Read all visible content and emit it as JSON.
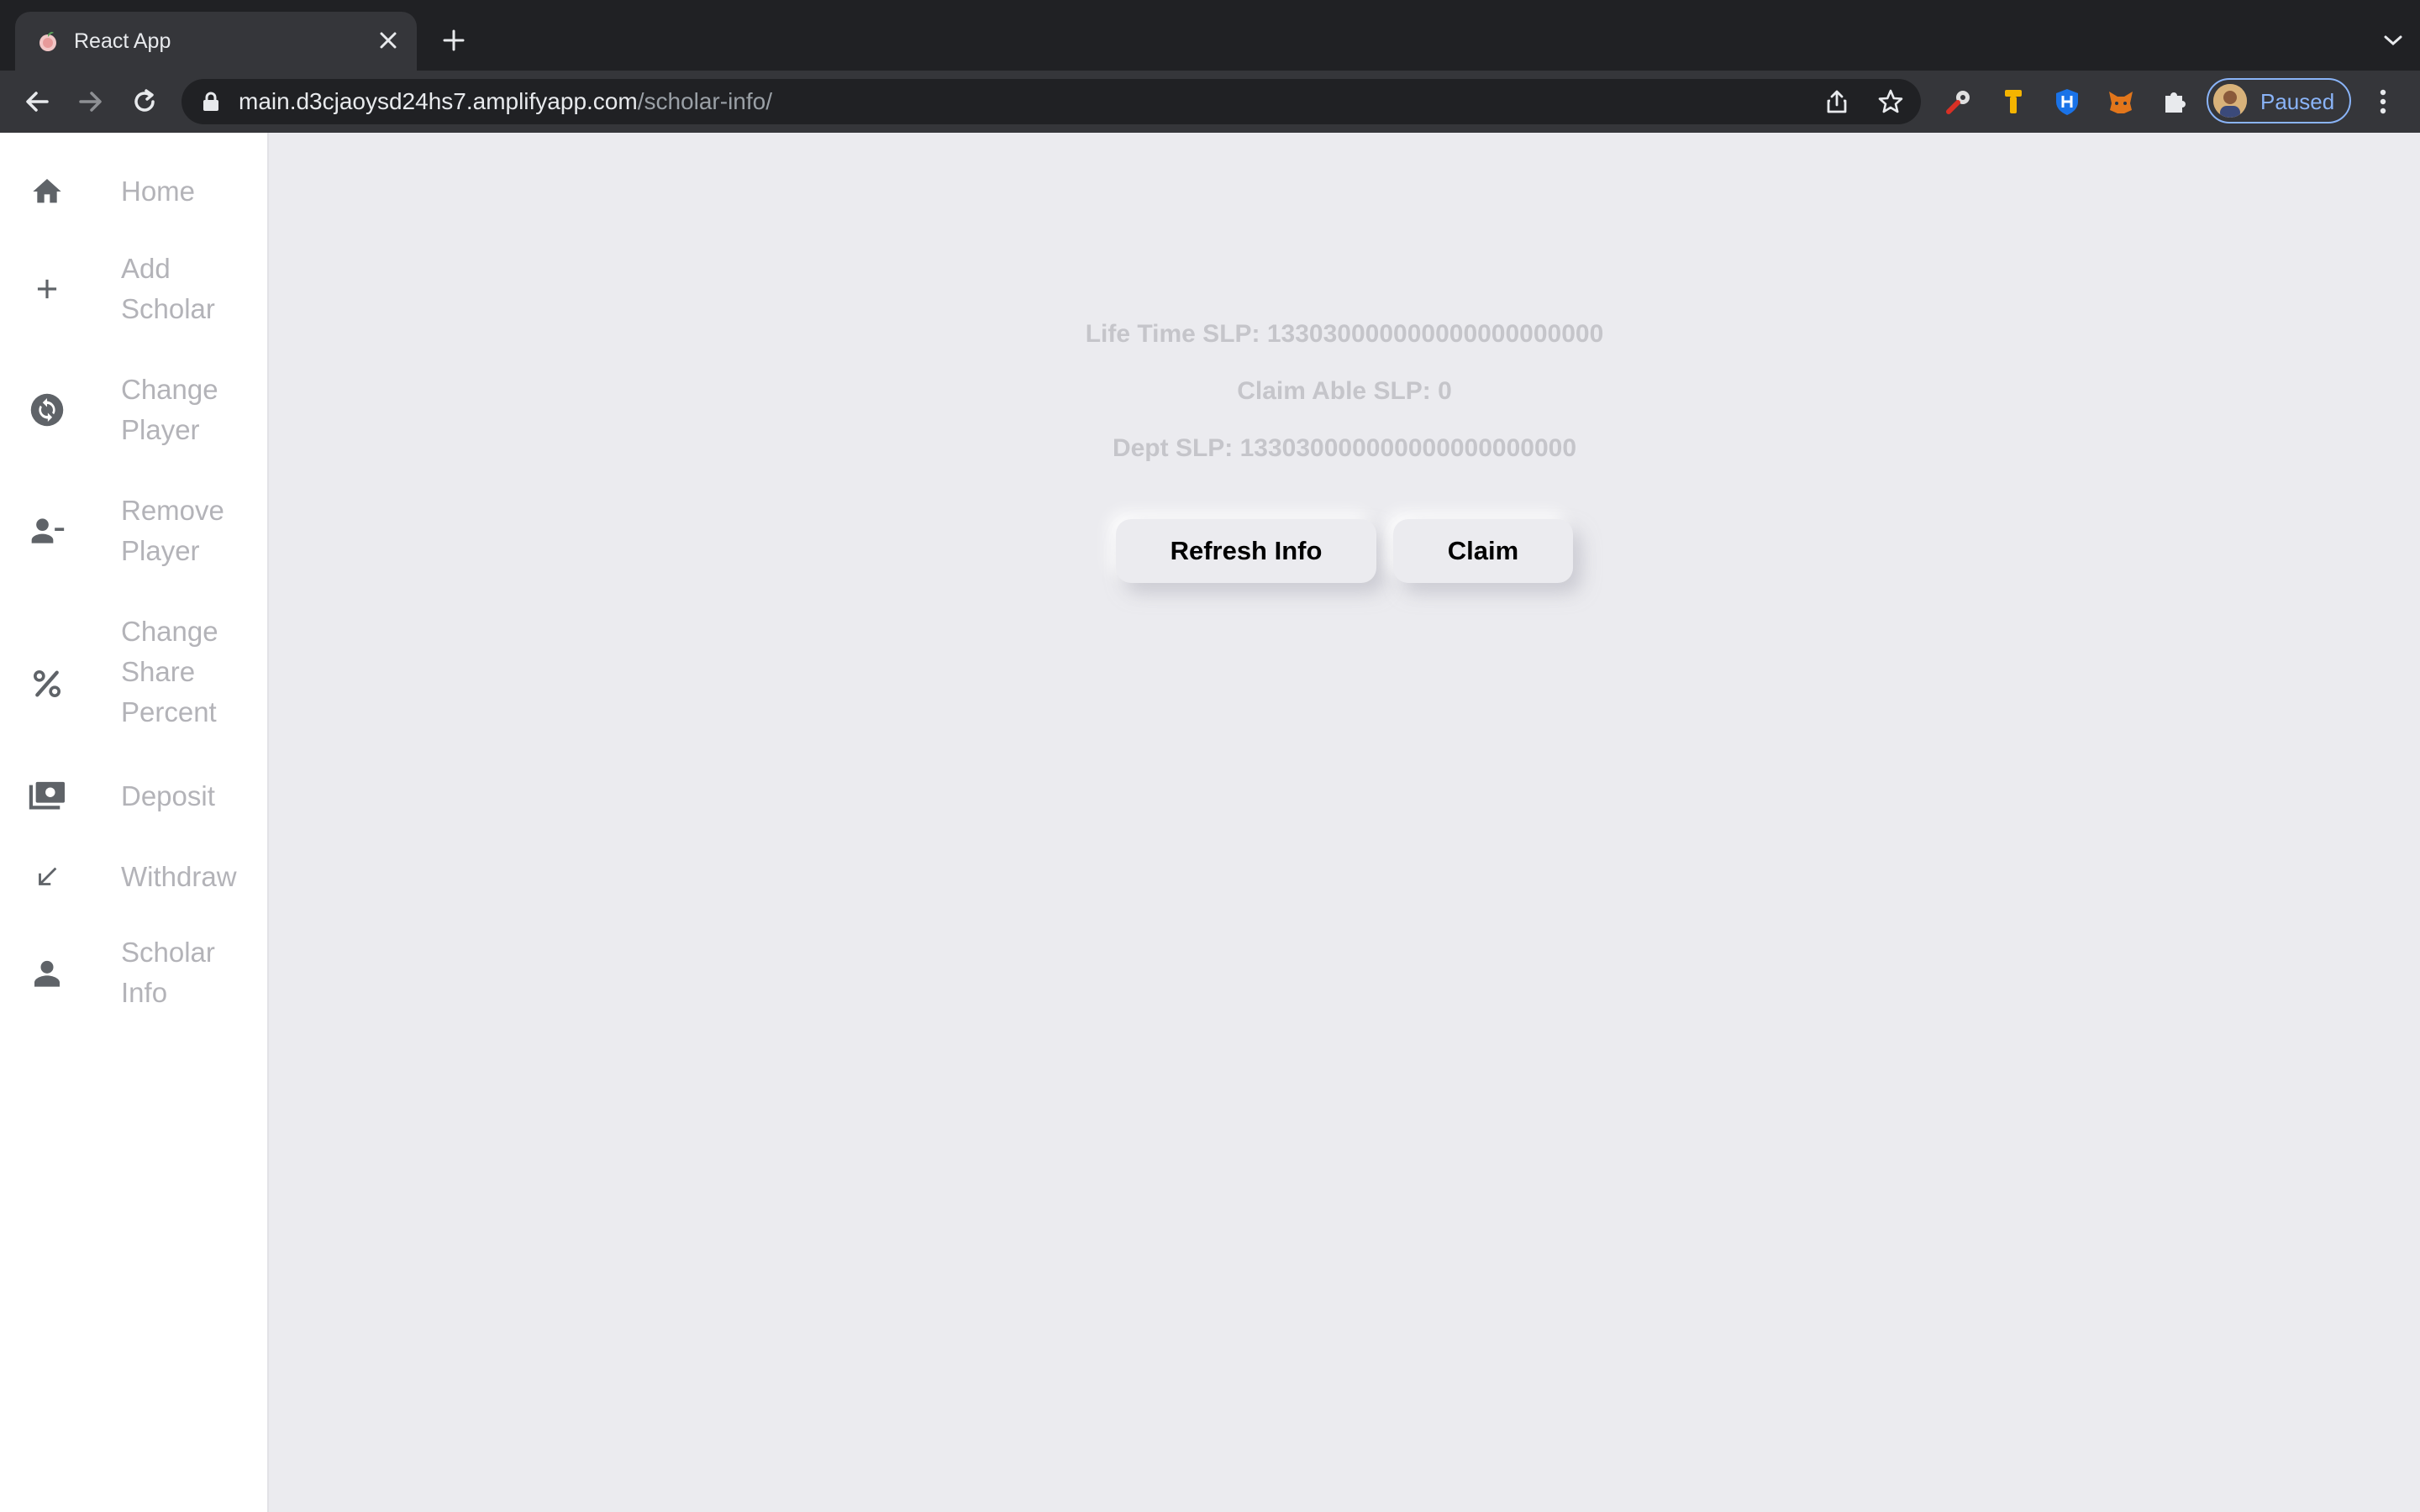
{
  "browser": {
    "tab": {
      "title": "React App"
    },
    "url": {
      "domain": "main.d3cjaoysd24hs7.amplifyapp.com",
      "path": "/scholar-info/"
    },
    "profile": {
      "status": "Paused"
    }
  },
  "sidebar": {
    "items": [
      {
        "label": "Home",
        "icon": "home-icon"
      },
      {
        "label": "Add Scholar",
        "icon": "plus-icon"
      },
      {
        "label": "Change Player",
        "icon": "sync-icon"
      },
      {
        "label": "Remove Player",
        "icon": "person-remove-icon"
      },
      {
        "label": "Change Share Percent",
        "icon": "percent-icon"
      },
      {
        "label": "Deposit",
        "icon": "cash-icon"
      },
      {
        "label": "Withdraw",
        "icon": "arrow-down-left-icon"
      },
      {
        "label": "Scholar Info",
        "icon": "person-icon"
      }
    ]
  },
  "scholar_info": {
    "lifetime_slp": "Life Time SLP: 133030000000000000000000",
    "claimable_slp": "Claim Able SLP: 0",
    "dept_slp": "Dept SLP: 133030000000000000000000"
  },
  "actions": {
    "refresh_label": "Refresh Info",
    "claim_label": "Claim"
  },
  "colors": {
    "sidebar_icon": "#5f6368",
    "sidebar_text": "#b3b3b8",
    "stat_text": "#c5c5ca",
    "page_bg": "#ebebef",
    "profile_accent": "#8ab4f8"
  }
}
